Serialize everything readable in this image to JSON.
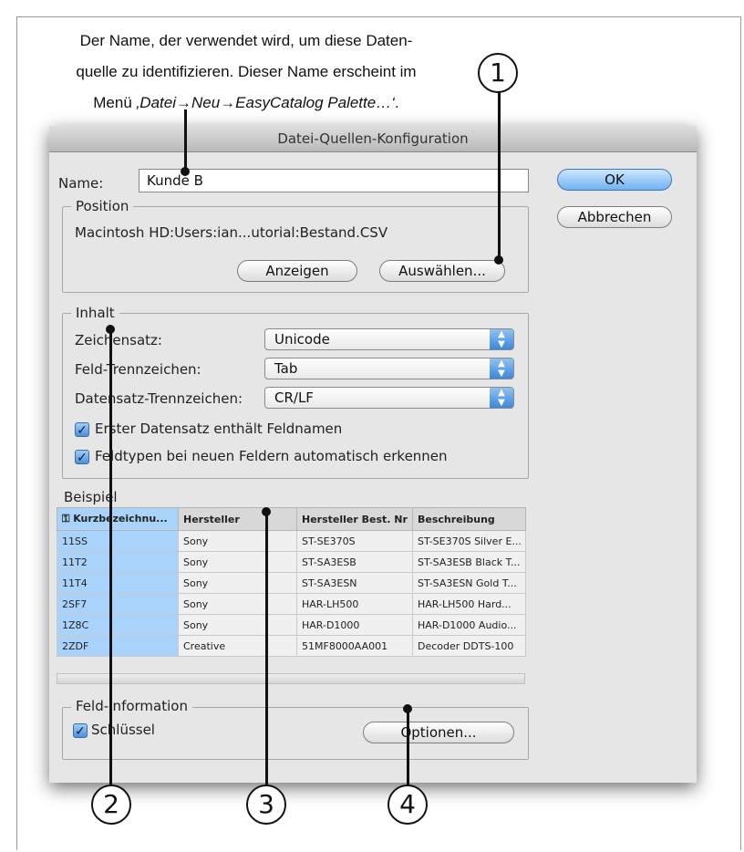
{
  "caption": {
    "line1": "Der Name, der verwendet wird, um diese Daten-",
    "line2": "quelle zu identifizieren. Dieser Name erscheint im",
    "line3_prefix": "Menü ",
    "line3_menu": "‚Datei→Neu→EasyCatalog Palette…‘",
    "line3_suffix": "."
  },
  "dialog": {
    "title": "Datei-Quellen-Konfiguration",
    "name_label": "Name:",
    "name_value": "Kunde B",
    "ok_label": "OK",
    "cancel_label": "Abbrechen",
    "position": {
      "legend": "Position",
      "path": "Macintosh HD:Users:ian...utorial:Bestand.CSV",
      "show_label": "Anzeigen",
      "choose_label": "Auswählen..."
    },
    "content": {
      "legend": "Inhalt",
      "charset_label": "Zeichensatz:",
      "charset_value": "Unicode",
      "field_sep_label": "Feld-Trennzeichen:",
      "field_sep_value": "Tab",
      "record_sep_label": "Datensatz-Trennzeichen:",
      "record_sep_value": "CR/LF",
      "first_record_label": "Erster Datensatz enthält Feldnamen",
      "first_record_checked": true,
      "auto_types_label": "Feldtypen bei neuen Feldern automatisch erkennen",
      "auto_types_checked": true
    },
    "example": {
      "label": "Beispiel",
      "columns": [
        "Kurzbezeichnu...",
        "Hersteller",
        "Hersteller Best. Nr",
        "Beschreibung"
      ],
      "rows": [
        [
          "11SS",
          "Sony",
          "ST-SE370S",
          "ST-SE370S Silver E..."
        ],
        [
          "11T2",
          "Sony",
          "ST-SA3ESB",
          "ST-SA3ESB Black T..."
        ],
        [
          "11T4",
          "Sony",
          "ST-SA3ESN",
          "ST-SA3ESN Gold T..."
        ],
        [
          "2SF7",
          "Sony",
          "HAR-LH500",
          "HAR-LH500 Hard..."
        ],
        [
          "1Z8C",
          "Sony",
          "HAR-D1000",
          "HAR-D1000 Audio..."
        ],
        [
          "2ZDF",
          "Creative",
          "51MF8000AA001",
          "Decoder DDTS-100"
        ]
      ]
    },
    "field_info": {
      "legend": "Feld-Information",
      "key_label": "Schlüssel",
      "key_checked": true,
      "options_label": "Optionen..."
    }
  },
  "callouts": [
    "1",
    "2",
    "3",
    "4"
  ],
  "icons": {
    "key": "key-icon",
    "checkmark": "checkmark-icon",
    "select_arrows": "updown-arrows-icon"
  },
  "colors": {
    "default_button": "#6fb2f2",
    "key_column": "#a9d3fb",
    "dialog_bg": "#e6e6e6"
  }
}
